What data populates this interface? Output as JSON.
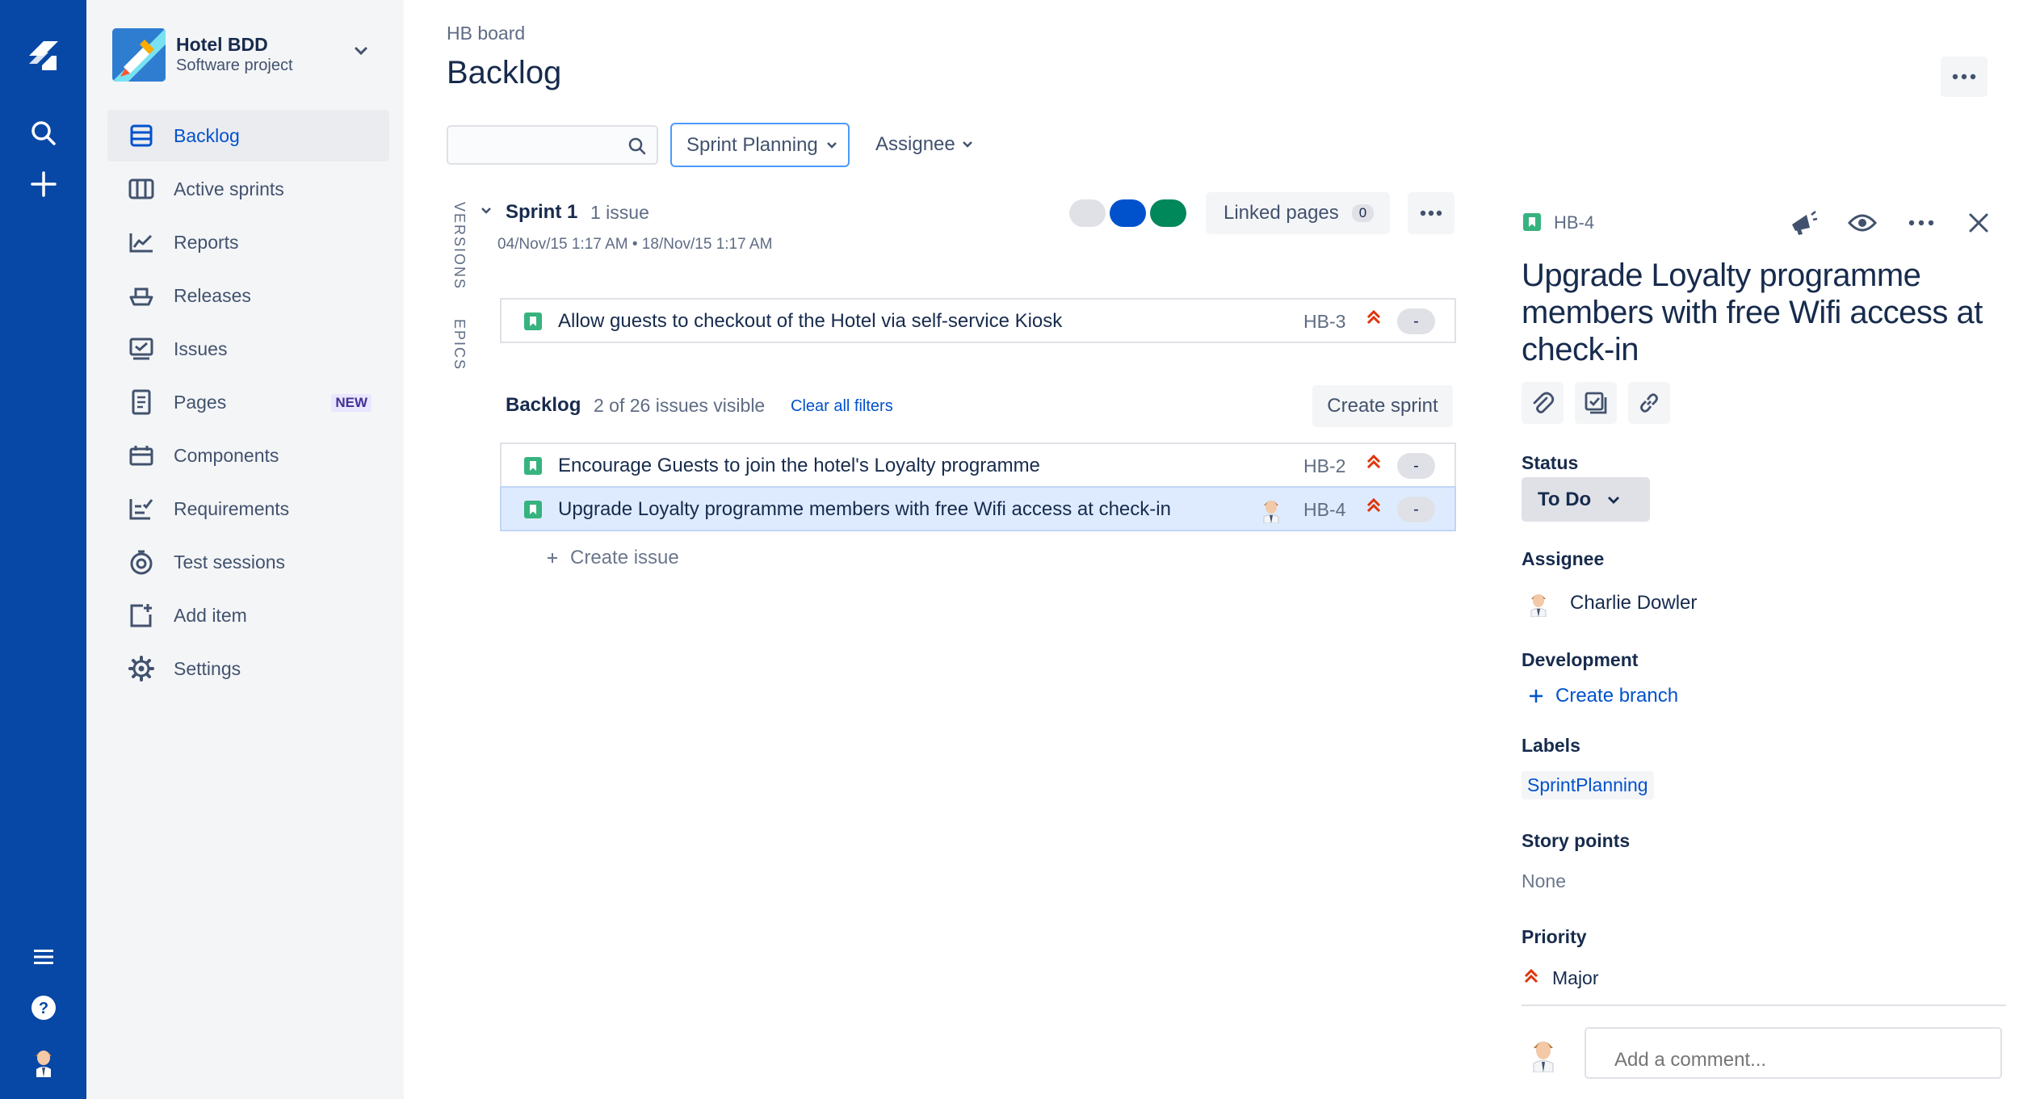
{
  "sidebar": {
    "project_name": "Hotel BDD",
    "project_type": "Software project",
    "items": [
      {
        "label": "Backlog",
        "icon": "backlog-icon"
      },
      {
        "label": "Active sprints",
        "icon": "board-icon"
      },
      {
        "label": "Reports",
        "icon": "chart-icon"
      },
      {
        "label": "Releases",
        "icon": "ship-icon"
      },
      {
        "label": "Issues",
        "icon": "issues-icon"
      },
      {
        "label": "Pages",
        "icon": "page-icon",
        "badge": "NEW"
      },
      {
        "label": "Components",
        "icon": "component-icon"
      },
      {
        "label": "Requirements",
        "icon": "requirements-icon"
      },
      {
        "label": "Test sessions",
        "icon": "test-sessions-icon"
      },
      {
        "label": "Add item",
        "icon": "add-item-icon"
      },
      {
        "label": "Settings",
        "icon": "gear-icon"
      }
    ]
  },
  "header": {
    "breadcrumb": "HB board",
    "title": "Backlog"
  },
  "filters": {
    "search_placeholder": "",
    "quick_filter": "Sprint Planning",
    "assignee": "Assignee"
  },
  "side_tabs": {
    "versions": "VERSIONS",
    "epics": "EPICS"
  },
  "sprint": {
    "name": "Sprint 1",
    "count": "1 issue",
    "dates": "04/Nov/15 1:17 AM • 18/Nov/15 1:17 AM",
    "linked_pages_label": "Linked pages",
    "linked_pages_count": "0",
    "status_dot_colors": [
      "#dfe1e6",
      "#0052cc",
      "#00875a"
    ],
    "issues": [
      {
        "summary": "Allow guests to checkout of the Hotel via self-service Kiosk",
        "key": "HB-3",
        "estimate": "-"
      }
    ]
  },
  "backlog": {
    "title": "Backlog",
    "visible": "2 of 26 issues visible",
    "clear_filters": "Clear all filters",
    "create_sprint": "Create sprint",
    "issues": [
      {
        "summary": "Encourage Guests to join the hotel's Loyalty programme",
        "key": "HB-2",
        "estimate": "-"
      },
      {
        "summary": "Upgrade Loyalty programme members with free Wifi access at check-in",
        "key": "HB-4",
        "estimate": "-"
      }
    ],
    "create_issue": "Create issue"
  },
  "detail": {
    "key": "HB-4",
    "title": "Upgrade Loyalty programme members with free Wifi access at check-in",
    "status_label": "Status",
    "status": "To Do",
    "assignee_label": "Assignee",
    "assignee": "Charlie Dowler",
    "development_label": "Development",
    "create_branch": "Create branch",
    "labels_label": "Labels",
    "label": "SprintPlanning",
    "story_points_label": "Story points",
    "story_points": "None",
    "priority_label": "Priority",
    "priority": "Major",
    "comment_placeholder": "Add a comment..."
  },
  "colors": {
    "rail": "#0747a6",
    "accent": "#0052cc",
    "story": "#36b37e",
    "priority": "#de350b"
  }
}
